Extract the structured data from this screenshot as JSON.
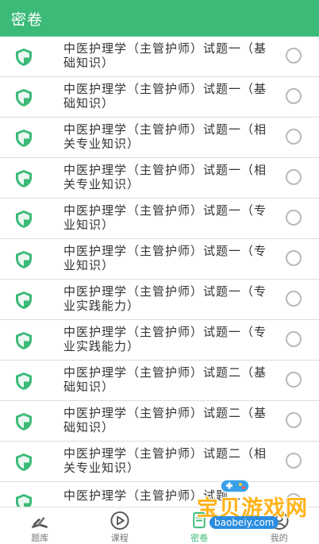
{
  "header": {
    "title": "密卷"
  },
  "colors": {
    "primary": "#3bba78",
    "shield": "#3bba78",
    "radio": "#b9b9b9"
  },
  "items": [
    {
      "label": "中医护理学（主管护师）试题一（基础知识）"
    },
    {
      "label": "中医护理学（主管护师）试题一（基础知识）"
    },
    {
      "label": "中医护理学（主管护师）试题一（相关专业知识）"
    },
    {
      "label": "中医护理学（主管护师）试题一（相关专业知识）"
    },
    {
      "label": "中医护理学（主管护师）试题一（专业知识）"
    },
    {
      "label": "中医护理学（主管护师）试题一（专业知识）"
    },
    {
      "label": "中医护理学（主管护师）试题一（专业实践能力）"
    },
    {
      "label": "中医护理学（主管护师）试题一（专业实践能力）"
    },
    {
      "label": "中医护理学（主管护师）试题二（基础知识）"
    },
    {
      "label": "中医护理学（主管护师）试题二（基础知识）"
    },
    {
      "label": "中医护理学（主管护师）试题二（相关专业知识）"
    },
    {
      "label": "中医护理学（主管护师）试题二"
    }
  ],
  "tabs": [
    {
      "label": "题库",
      "icon": "book-icon"
    },
    {
      "label": "课程",
      "icon": "play-icon"
    },
    {
      "label": "密卷",
      "icon": "paper-icon"
    },
    {
      "label": "我的",
      "icon": "user-icon"
    }
  ],
  "watermark": {
    "brand": "宝贝游戏网",
    "url": "baobeiy.com"
  }
}
